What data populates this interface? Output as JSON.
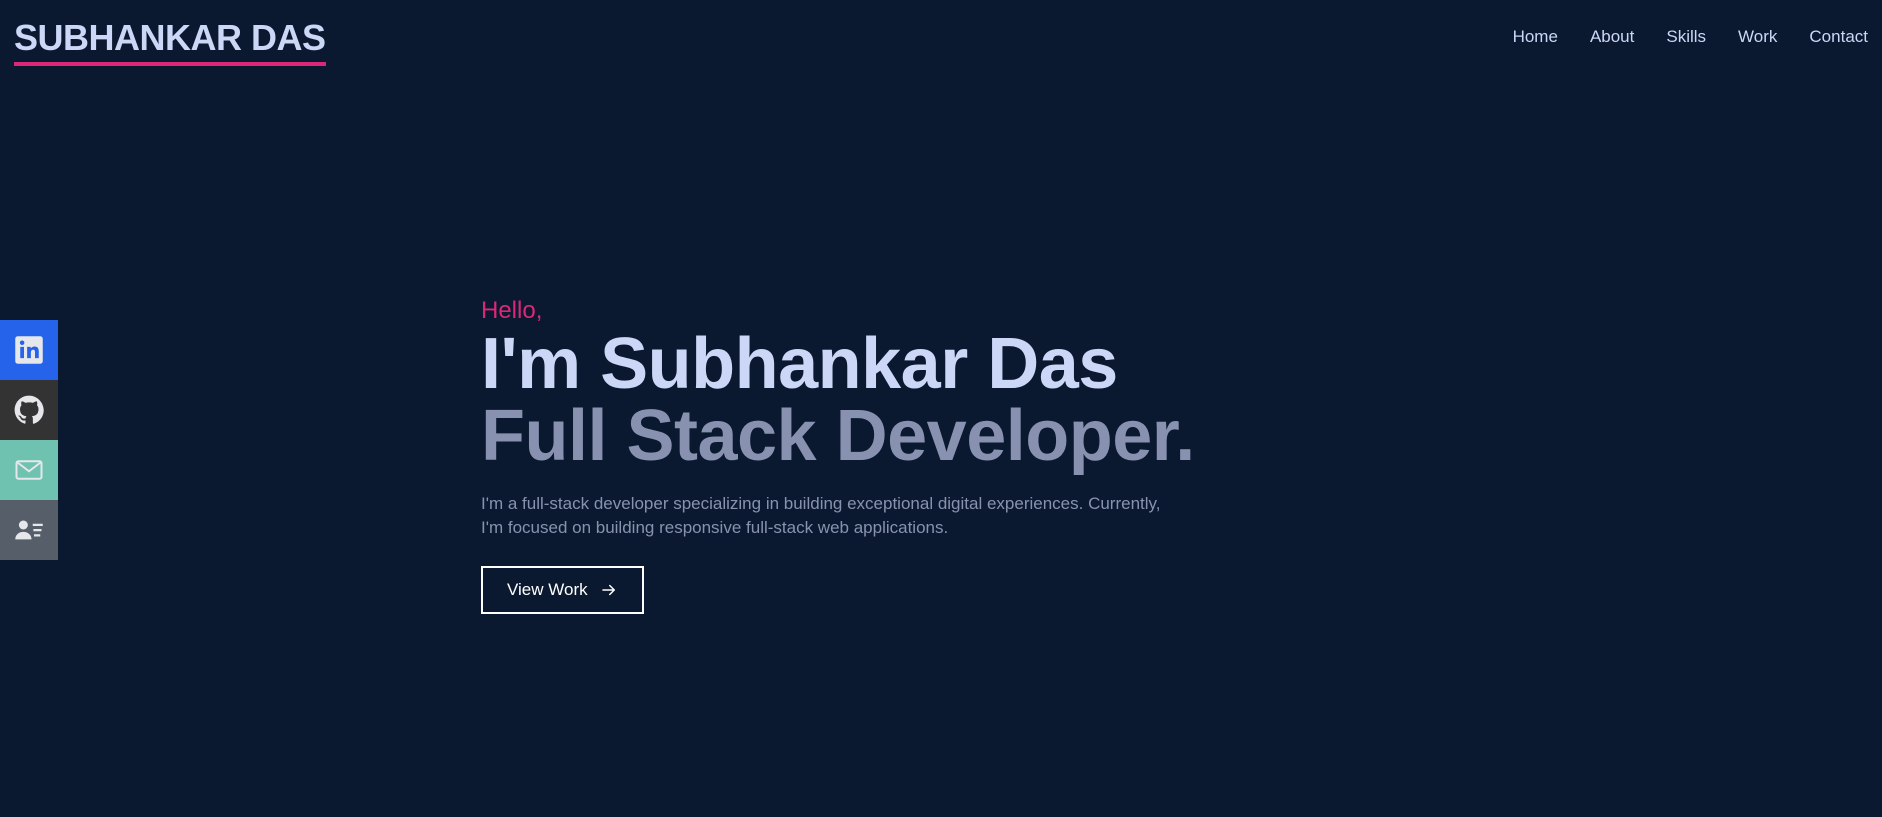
{
  "header": {
    "logo": "SUBHANKAR DAS",
    "nav": [
      {
        "label": "Home"
      },
      {
        "label": "About"
      },
      {
        "label": "Skills"
      },
      {
        "label": "Work"
      },
      {
        "label": "Contact"
      }
    ]
  },
  "social": [
    {
      "icon": "linkedin-icon",
      "color": "#2563eb"
    },
    {
      "icon": "github-icon",
      "color": "#333333"
    },
    {
      "icon": "mail-icon",
      "color": "#6fc2b0"
    },
    {
      "icon": "resume-icon",
      "color": "#565f69"
    }
  ],
  "hero": {
    "greeting": "Hello,",
    "name": "I'm Subhankar Das",
    "role": "Full Stack Developer.",
    "description": "I'm a full-stack developer specializing in building exceptional digital experiences. Currently, I'm focused on building responsive full-stack web applications.",
    "button_label": "View Work"
  },
  "colors": {
    "background": "#0a192f",
    "accent": "#db2777",
    "heading": "#ccd6f6",
    "muted": "#8892b0"
  }
}
